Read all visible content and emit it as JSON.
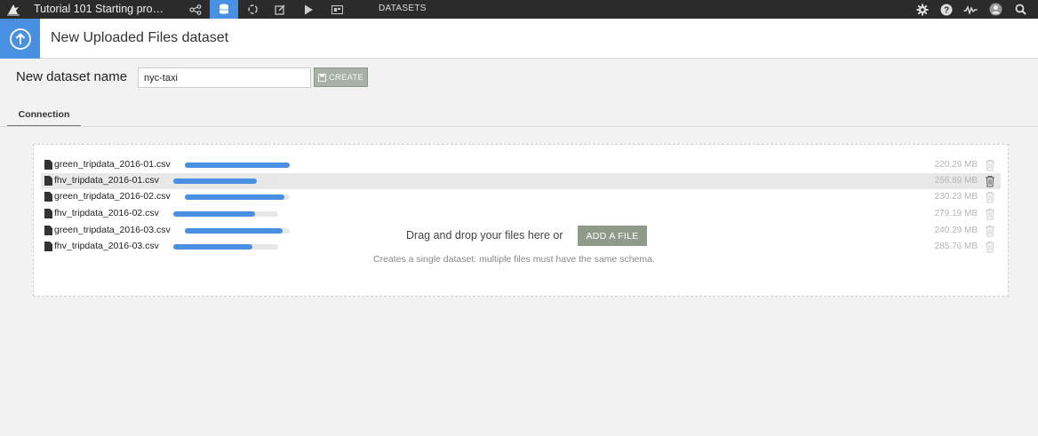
{
  "topbar": {
    "project_title": "Tutorial 101 Starting pro…",
    "section_label": "DATASETS",
    "nav_icons": [
      "flow-icon",
      "datasets-icon",
      "recipes-icon",
      "notebooks-icon",
      "play-icon",
      "dashboard-icon"
    ],
    "right_icons": [
      "gear-icon",
      "help-icon",
      "activity-icon",
      "user-icon",
      "search-icon"
    ]
  },
  "header": {
    "title": "New Uploaded Files dataset",
    "badge_icon": "upload-icon"
  },
  "form": {
    "name_label": "New dataset name",
    "name_value": "nyc-taxi",
    "create_label": "CREATE"
  },
  "tabs": [
    {
      "label": "Connection",
      "active": true
    }
  ],
  "files": [
    {
      "name": "green_tripdata_2016-01.csv",
      "size": "220.29 MB",
      "progress": 1.0
    },
    {
      "name": "fhv_tripdata_2016-01.csv",
      "size": "256.89 MB",
      "progress": 0.8
    },
    {
      "name": "green_tripdata_2016-02.csv",
      "size": "230.23 MB",
      "progress": 0.95
    },
    {
      "name": "fhv_tripdata_2016-02.csv",
      "size": "279.19 MB",
      "progress": 0.78
    },
    {
      "name": "green_tripdata_2016-03.csv",
      "size": "240.29 MB",
      "progress": 0.93
    },
    {
      "name": "fhv_tripdata_2016-03.csv",
      "size": "285.76 MB",
      "progress": 0.75
    }
  ],
  "dropzone": {
    "drag_text": "Drag and drop your files here or",
    "add_file_label": "ADD A FILE",
    "hint": "Creates a single dataset: multiple files must have the same schema."
  },
  "colors": {
    "accent": "#4a90e2",
    "topbar": "#2b2b2b",
    "button_gray": "#8f9a8b"
  }
}
